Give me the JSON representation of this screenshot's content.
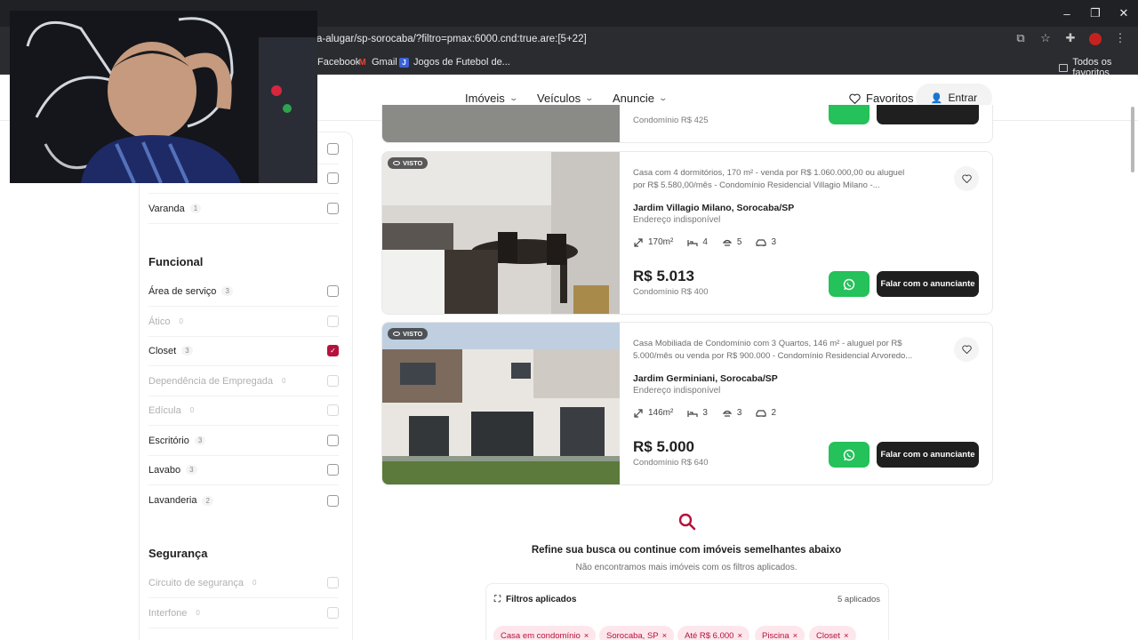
{
  "browser": {
    "url": "a-alugar/sp-sorocaba/?filtro=pmax:6000.cnd:true.are:[5+22]",
    "window_controls": [
      "–",
      "❐",
      "✕"
    ],
    "bookmarks": [
      {
        "label": "Facebook",
        "icon": "facebook-icon"
      },
      {
        "label": "Gmail",
        "icon": "gmail-icon"
      },
      {
        "label": "Jogos de Futebol de...",
        "icon": "site-icon"
      }
    ],
    "all_bookmarks": "Todos os favoritos"
  },
  "header": {
    "nav": [
      {
        "label": "Imóveis"
      },
      {
        "label": "Veículos"
      },
      {
        "label": "Anuncie"
      }
    ],
    "favorites": "Favoritos",
    "login": "Entrar"
  },
  "sidebar": {
    "top_rows": [
      {
        "label": "Varanda",
        "count": "1",
        "disabled": false,
        "checked": false
      }
    ],
    "sections": [
      {
        "title": "Funcional",
        "items": [
          {
            "label": "Área de serviço",
            "count": "3",
            "disabled": false,
            "checked": false
          },
          {
            "label": "Ático",
            "count": "0",
            "disabled": true,
            "checked": false
          },
          {
            "label": "Closet",
            "count": "3",
            "disabled": false,
            "checked": true
          },
          {
            "label": "Dependência de Empregada",
            "count": "0",
            "disabled": true,
            "checked": false
          },
          {
            "label": "Edícula",
            "count": "0",
            "disabled": true,
            "checked": false
          },
          {
            "label": "Escritório",
            "count": "3",
            "disabled": false,
            "checked": false
          },
          {
            "label": "Lavabo",
            "count": "3",
            "disabled": false,
            "checked": false
          },
          {
            "label": "Lavanderia",
            "count": "2",
            "disabled": false,
            "checked": false
          }
        ]
      },
      {
        "title": "Segurança",
        "items": [
          {
            "label": "Circuito de segurança",
            "count": "0",
            "disabled": true,
            "checked": false
          },
          {
            "label": "Interfone",
            "count": "0",
            "disabled": true,
            "checked": false
          }
        ]
      }
    ]
  },
  "listings": {
    "partial_condo": "Condomínio R$ 425",
    "items": [
      {
        "badge": "VISTO",
        "description": "Casa com 4 dormitórios, 170 m² - venda por R$ 1.060.000,00 ou aluguel por R$ 5.580,00/mês - Condomínio Residencial Villagio Milano -...",
        "location": "Jardim Villagio Milano, Sorocaba/SP",
        "address": "Endereço indisponível",
        "area": "170m²",
        "bedrooms": "4",
        "bathrooms": "5",
        "parking": "3",
        "price": "R$ 5.013",
        "condo": "Condomínio R$ 400",
        "cta": "Falar com o anunciante"
      },
      {
        "badge": "VISTO",
        "description": "Casa Mobiliada de Condomínio com 3 Quartos, 146 m² - aluguel por R$ 5.000/mês ou venda por R$ 900.000 - Condomínio Residencial Arvoredo...",
        "location": "Jardim Germiniani, Sorocaba/SP",
        "address": "Endereço indisponível",
        "area": "146m²",
        "bedrooms": "3",
        "bathrooms": "3",
        "parking": "2",
        "price": "R$ 5.000",
        "condo": "Condomínio R$ 640",
        "cta": "Falar com o anunciante"
      }
    ]
  },
  "refine": {
    "title": "Refine sua busca ou continue com imóveis semelhantes abaixo",
    "subtitle": "Não encontramos mais imóveis com os filtros aplicados."
  },
  "applied_filters": {
    "title": "Filtros aplicados",
    "count": "5 aplicados",
    "chips": [
      "Casa em condomínio",
      "Sorocaba, SP",
      "Até R$ 6.000",
      "Piscina",
      "Closet"
    ]
  },
  "colors": {
    "accent": "#b5123d",
    "whatsapp": "#25c15a",
    "dark_button": "#1f1f1f",
    "chip_bg": "#fde7ec"
  }
}
